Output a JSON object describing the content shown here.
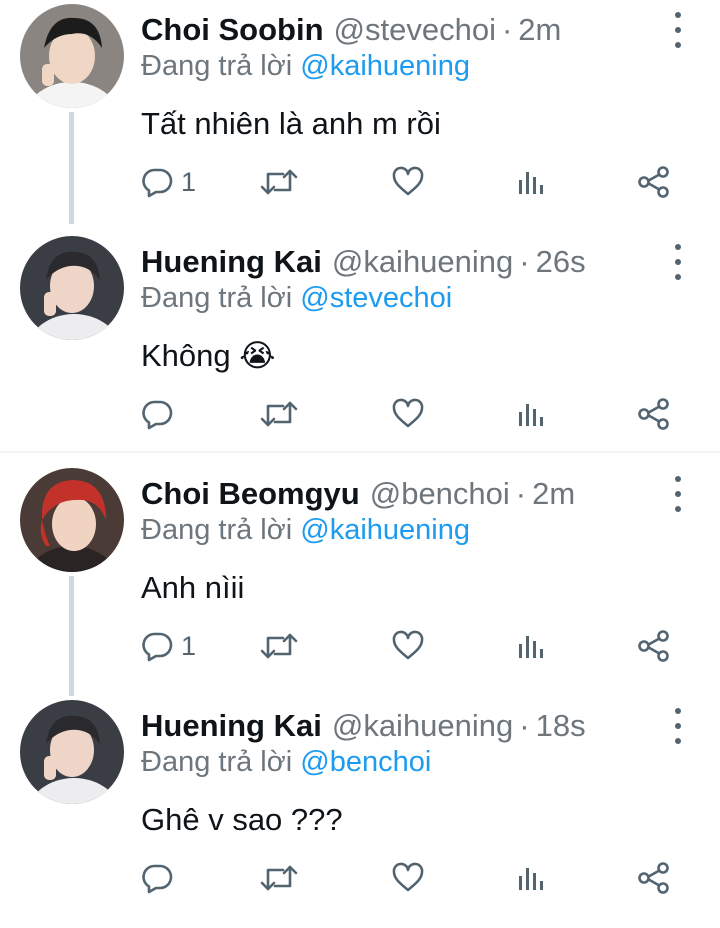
{
  "tweets": [
    {
      "name": "Choi Soobin",
      "handle": "@stevechoi",
      "dot": "·",
      "time": "2m",
      "replying_prefix": "Đang trả lời",
      "replying_to": "@kaihuening",
      "text": "Tất nhiên là anh m rồi",
      "reply_count": "1",
      "avatar_hair": "#1c1c1c",
      "avatar_bg": "#8a8580"
    },
    {
      "name": "Huening Kai",
      "handle": "@kaihuening",
      "dot": "·",
      "time": "26s",
      "replying_prefix": "Đang trả lời",
      "replying_to": "@stevechoi",
      "text": "Không 😭",
      "reply_count": "",
      "avatar_hair": "#2a2a2e",
      "avatar_bg": "#3b3d44"
    },
    {
      "name": "Choi Beomgyu",
      "handle": "@benchoi",
      "dot": "·",
      "time": "2m",
      "replying_prefix": "Đang trả lời",
      "replying_to": "@kaihuening",
      "text": "Anh nìii",
      "reply_count": "1",
      "avatar_hair": "#c2312a",
      "avatar_bg": "#4a3b36"
    },
    {
      "name": "Huening Kai",
      "handle": "@kaihuening",
      "dot": "·",
      "time": "18s",
      "replying_prefix": "Đang trả lời",
      "replying_to": "@benchoi",
      "text": "Ghê v sao ???",
      "reply_count": "",
      "avatar_hair": "#2a2a2e",
      "avatar_bg": "#3b3d44"
    }
  ],
  "colors": {
    "link": "#1d9bf0",
    "muted": "#6e767d",
    "icon": "#536471",
    "thread_line": "#cfd9de"
  },
  "icons": [
    "reply-icon",
    "retweet-icon",
    "like-icon",
    "view-stats-icon",
    "share-icon",
    "more-options-icon"
  ]
}
